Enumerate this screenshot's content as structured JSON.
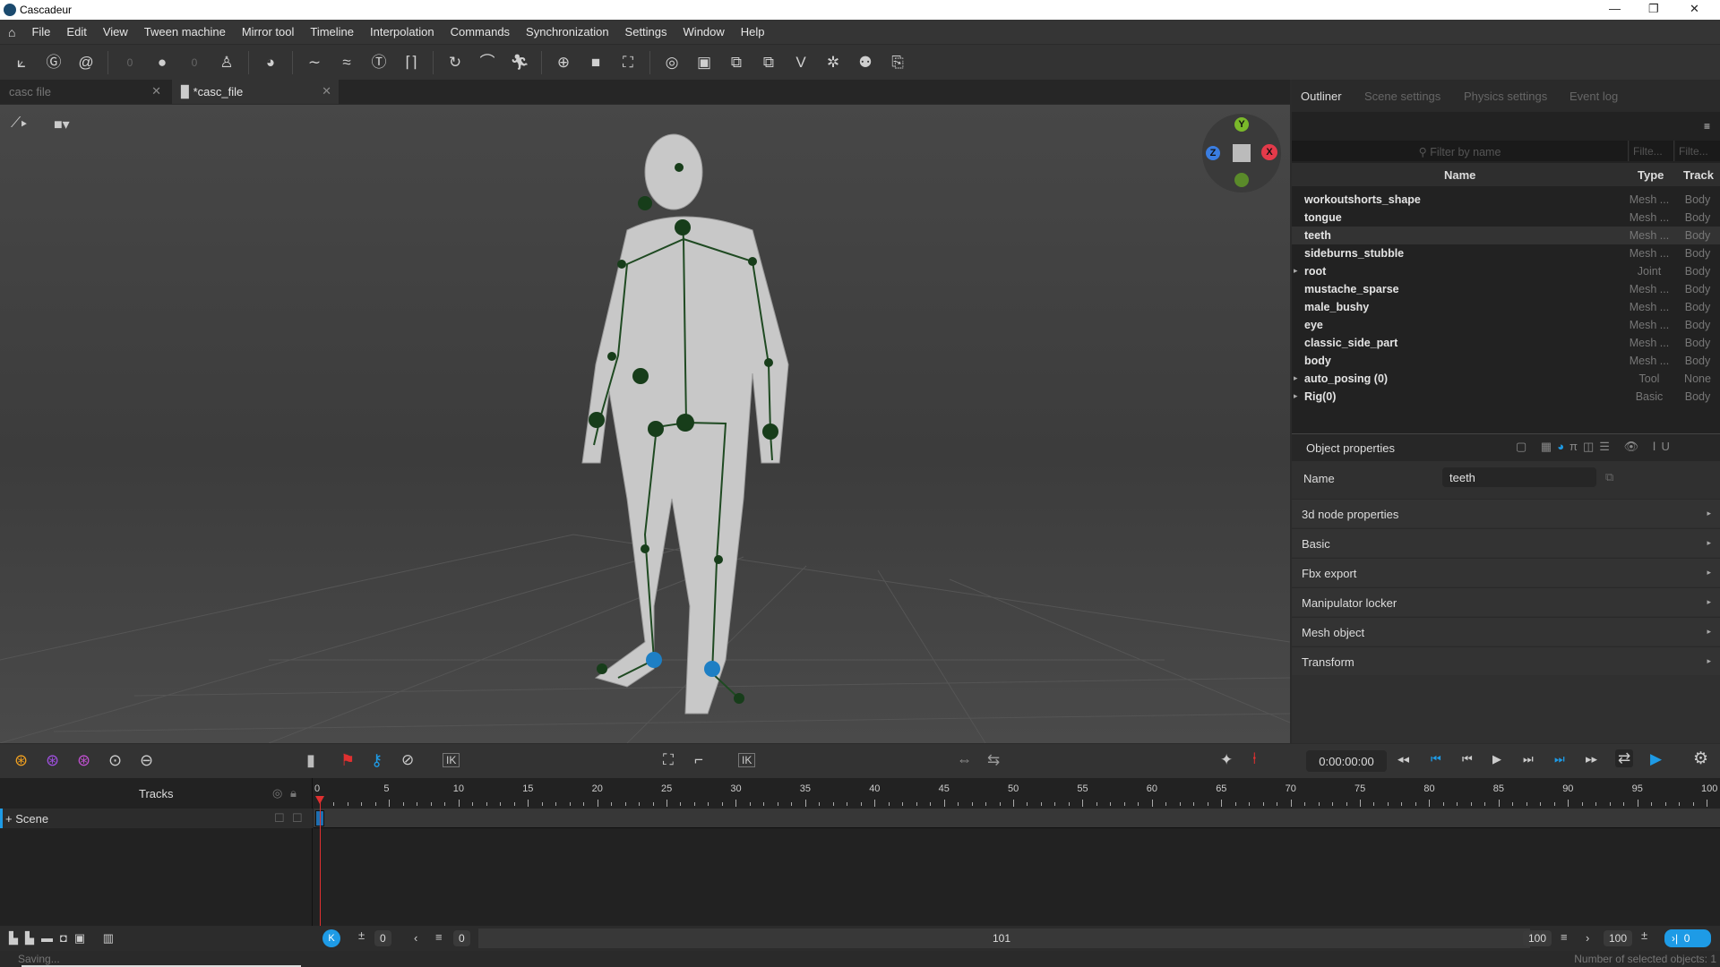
{
  "window": {
    "title": "Cascadeur",
    "minimize": "—",
    "restore": "❐",
    "close": "✕"
  },
  "menu": [
    "File",
    "Edit",
    "View",
    "Tween machine",
    "Mirror tool",
    "Timeline",
    "Interpolation",
    "Commands",
    "Synchronization",
    "Settings",
    "Window",
    "Help"
  ],
  "toolbar_values": {
    "left_num": "0",
    "right_num": "0"
  },
  "doc_tabs": [
    {
      "label": "casc file",
      "active": false
    },
    {
      "label": "*casc_file",
      "active": true
    }
  ],
  "gizmo": {
    "y": "Y",
    "x": "X",
    "z": "Z"
  },
  "right_tabs": [
    "Outliner",
    "Scene settings",
    "Physics settings",
    "Event log"
  ],
  "outliner": {
    "filter_placeholder": "Filter by name",
    "filter_type": "Filte...",
    "filter_track": "Filte...",
    "columns": {
      "name": "Name",
      "type": "Type",
      "track": "Track"
    },
    "rows": [
      {
        "name": "workoutshorts_shape",
        "type": "Mesh ...",
        "track": "Body"
      },
      {
        "name": "tongue",
        "type": "Mesh ...",
        "track": "Body"
      },
      {
        "name": "teeth",
        "type": "Mesh ...",
        "track": "Body",
        "selected": true
      },
      {
        "name": "sideburns_stubble",
        "type": "Mesh ...",
        "track": "Body"
      },
      {
        "name": "root",
        "type": "Joint",
        "track": "Body",
        "expandable": true
      },
      {
        "name": "mustache_sparse",
        "type": "Mesh ...",
        "track": "Body"
      },
      {
        "name": "male_bushy",
        "type": "Mesh ...",
        "track": "Body"
      },
      {
        "name": "eye",
        "type": "Mesh ...",
        "track": "Body"
      },
      {
        "name": "classic_side_part",
        "type": "Mesh ...",
        "track": "Body"
      },
      {
        "name": "body",
        "type": "Mesh ...",
        "track": "Body"
      },
      {
        "name": "auto_posing (0)",
        "type": "Tool",
        "track": "None",
        "expandable": true
      },
      {
        "name": "Rig(0)",
        "type": "Basic",
        "track": "Body",
        "expandable": true
      }
    ]
  },
  "object_properties": {
    "title": "Object properties",
    "name_label": "Name",
    "name_value": "teeth",
    "sections": [
      "3d  node  properties",
      "Basic",
      "Fbx export",
      "Manipulator locker",
      "Mesh object",
      "Transform"
    ]
  },
  "timeline": {
    "time": "0:00:00:00",
    "tracks_label": "Tracks",
    "scene_label": "+ Scene",
    "ticks": [
      "0",
      "5",
      "10",
      "15",
      "20",
      "25",
      "30",
      "35",
      "40",
      "45",
      "50",
      "55",
      "60",
      "65",
      "70",
      "75",
      "80",
      "85",
      "90",
      "95",
      "100"
    ],
    "current_frame": 0
  },
  "bottom": {
    "start": "0",
    "step": "0",
    "total": "101",
    "end1": "100",
    "end2": "100",
    "end_frame": "0"
  },
  "status": {
    "left": "Saving...",
    "right": "Number of selected objects: 1"
  },
  "colors": {
    "accent": "#1e9be6",
    "bg": "#2b2b2b",
    "skeleton": "#1f4a22",
    "playhead": "#e03030"
  }
}
